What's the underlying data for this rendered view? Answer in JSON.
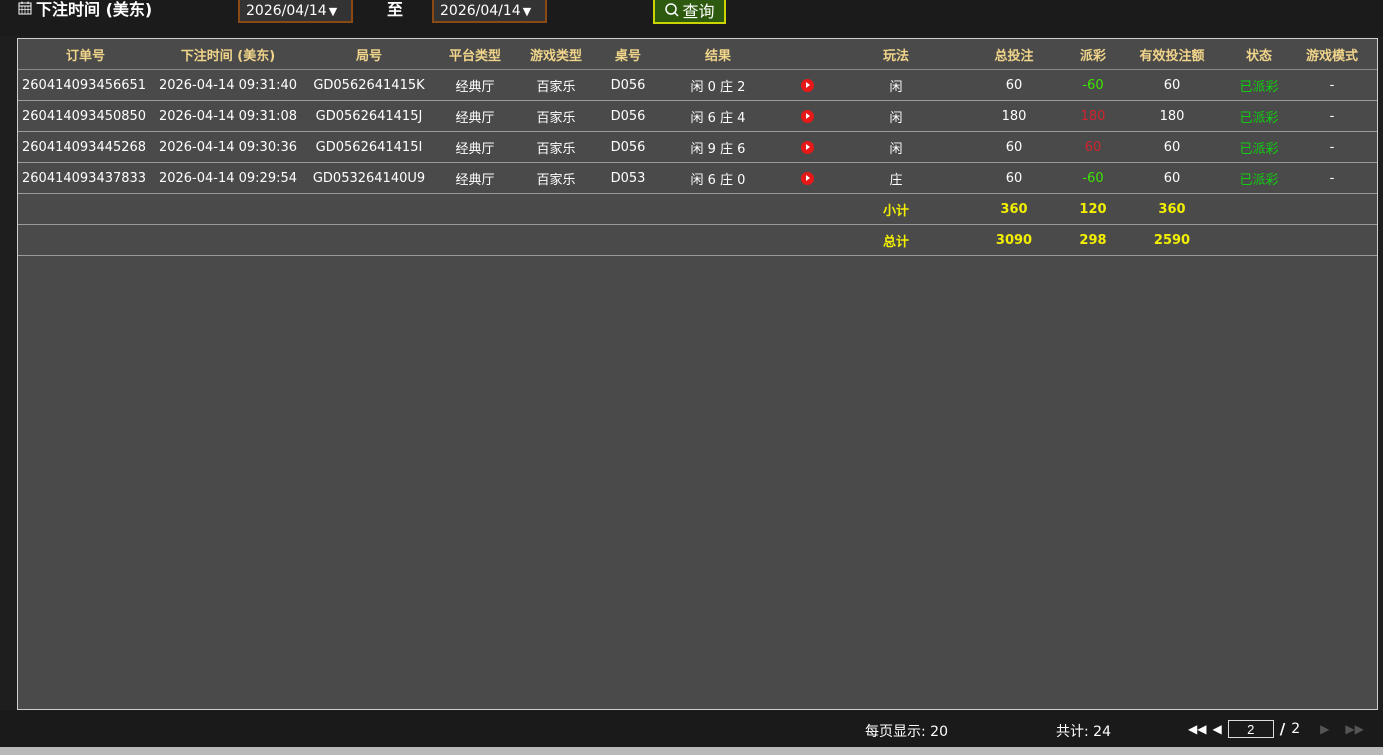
{
  "filter": {
    "label": "下注时间 (美东)",
    "from_date": "2026/04/14",
    "to_label": "至",
    "to_date": "2026/04/14",
    "query_label": "查询",
    "dropdown_glyph": "▼"
  },
  "table": {
    "headers": [
      "订单号",
      "下注时间 (美东)",
      "局号",
      "平台类型",
      "游戏类型",
      "桌号",
      "结果",
      "",
      "玩法",
      "总投注",
      "派彩",
      "有效投注额",
      "状态",
      "游戏模式"
    ],
    "rows": [
      {
        "order": "260414093456651",
        "time": "2026-04-14 09:31:40",
        "round": "GD0562641415K",
        "platform": "经典厅",
        "game": "百家乐",
        "table": "D056",
        "result": "闲 0 庄 2",
        "play": "闲",
        "bet": "60",
        "payout": "-60",
        "payout_type": "neg",
        "valid": "60",
        "status": "已派彩",
        "mode": "-"
      },
      {
        "order": "260414093450850",
        "time": "2026-04-14 09:31:08",
        "round": "GD0562641415J",
        "platform": "经典厅",
        "game": "百家乐",
        "table": "D056",
        "result": "闲 6 庄 4",
        "play": "闲",
        "bet": "180",
        "payout": "180",
        "payout_type": "pos",
        "valid": "180",
        "status": "已派彩",
        "mode": "-"
      },
      {
        "order": "260414093445268",
        "time": "2026-04-14 09:30:36",
        "round": "GD0562641415I",
        "platform": "经典厅",
        "game": "百家乐",
        "table": "D056",
        "result": "闲 9 庄 6",
        "play": "闲",
        "bet": "60",
        "payout": "60",
        "payout_type": "pos",
        "valid": "60",
        "status": "已派彩",
        "mode": "-"
      },
      {
        "order": "260414093437833",
        "time": "2026-04-14 09:29:54",
        "round": "GD053264140U9",
        "platform": "经典厅",
        "game": "百家乐",
        "table": "D053",
        "result": "闲 6 庄 0",
        "play": "庄",
        "bet": "60",
        "payout": "-60",
        "payout_type": "neg",
        "valid": "60",
        "status": "已派彩",
        "mode": "-"
      }
    ],
    "subtotal": {
      "label": "小计",
      "bet": "360",
      "payout": "120",
      "valid": "360"
    },
    "total": {
      "label": "总计",
      "bet": "3090",
      "payout": "298",
      "valid": "2590"
    }
  },
  "footer": {
    "per_page": "每页显示: 20",
    "total": "共计: 24",
    "current_page": "2",
    "separator": "/",
    "total_pages": "2"
  },
  "colors": {
    "header_text": "#f0d48a",
    "negative": "#3ee600",
    "positive": "#d2232e",
    "status": "#11cc11",
    "summary": "#f2ef00"
  }
}
